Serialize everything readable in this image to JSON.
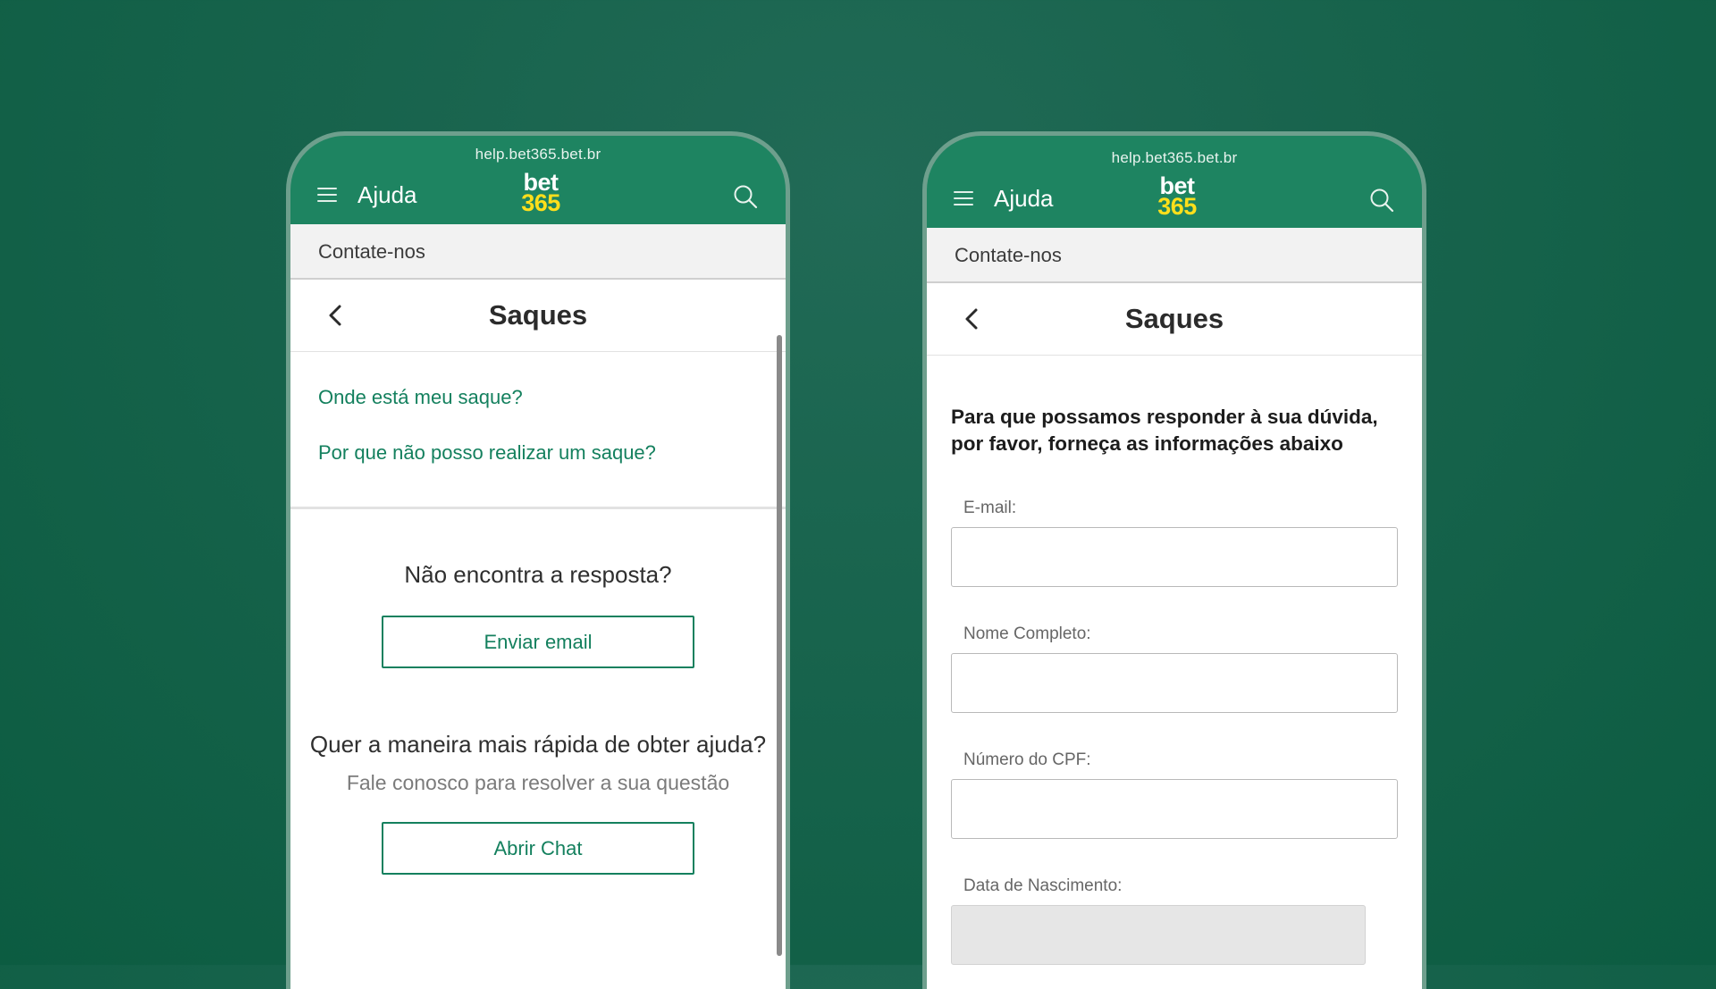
{
  "left_phone": {
    "url": "help.bet365.bet.br",
    "header": {
      "title": "Ajuda",
      "logo_top": "bet",
      "logo_bottom": "365"
    },
    "breadcrumb": "Contate-nos",
    "page_title": "Saques",
    "links": [
      {
        "label": "Onde está meu saque?"
      },
      {
        "label": "Por que não posso realizar um saque?"
      }
    ],
    "help": {
      "question": "Não encontra a resposta?",
      "email_button": "Enviar email",
      "fast_question": "Quer a maneira mais rápida de obter ajuda?",
      "fast_sub": "Fale conosco para resolver a sua questão",
      "chat_button": "Abrir Chat"
    }
  },
  "right_phone": {
    "url": "help.bet365.bet.br",
    "header": {
      "title": "Ajuda",
      "logo_top": "bet",
      "logo_bottom": "365"
    },
    "breadcrumb": "Contate-nos",
    "page_title": "Saques",
    "form": {
      "intro": "Para que possamos responder à sua dúvida, por favor, forneça as informações abaixo",
      "fields": [
        {
          "label": "E-mail:",
          "value": ""
        },
        {
          "label": "Nome Completo:",
          "value": ""
        },
        {
          "label": "Número do CPF:",
          "value": ""
        },
        {
          "label": "Data de Nascimento:",
          "value": ""
        }
      ]
    }
  },
  "colors": {
    "brand_green": "#1e8461",
    "link_green": "#14805e",
    "logo_yellow": "#ffdf1b",
    "background": "#17634c"
  },
  "icons": [
    "hamburger-icon",
    "search-icon",
    "chevron-left-icon"
  ]
}
